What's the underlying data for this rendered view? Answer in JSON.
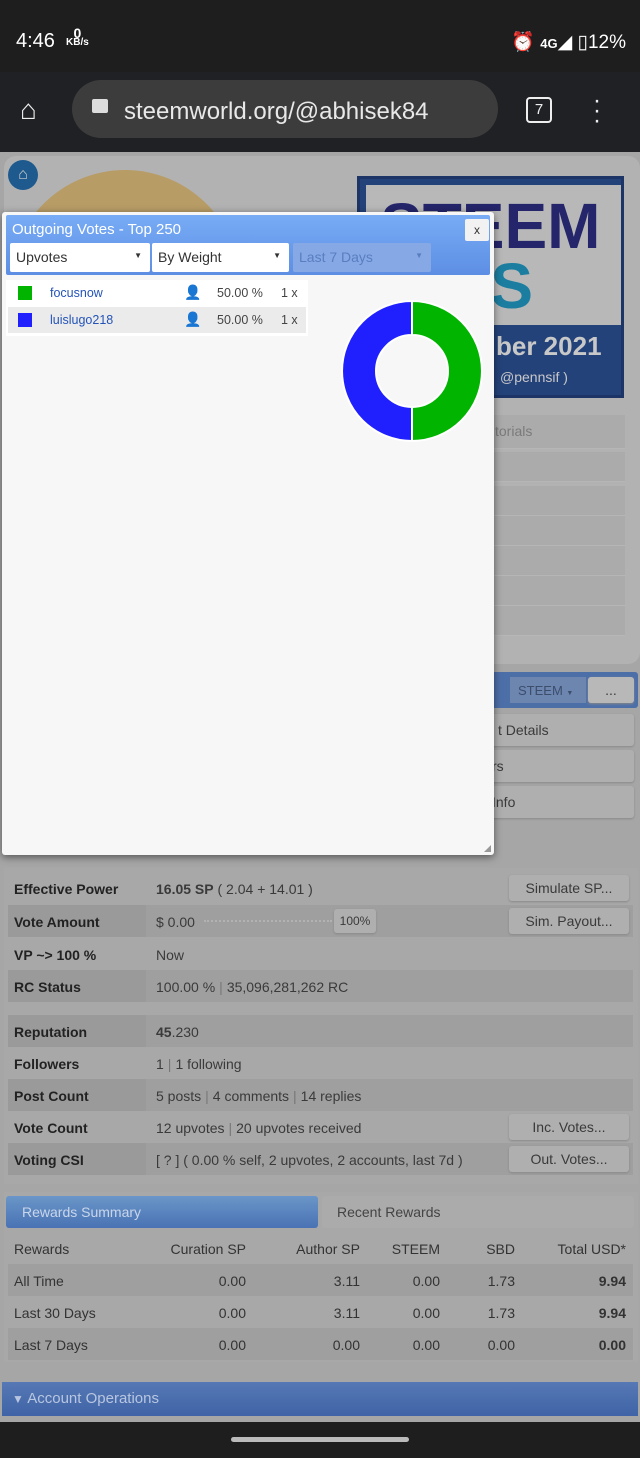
{
  "status_bar": {
    "time": "4:46",
    "speed_value": "0",
    "speed_unit": "KB/s",
    "icons": [
      "alarm-icon",
      "volte-icon",
      "4g-signal-icon",
      "battery-icon"
    ],
    "net": "4G",
    "battery": "12%"
  },
  "browser": {
    "url": "steemworld.org/@abhisek84",
    "tab_count": "7"
  },
  "background": {
    "banner_line1": "STEEM",
    "banner_line2": "WS",
    "banner_date": "ber 2021",
    "banner_author": "@pennsif )",
    "menu_first": "torials",
    "wallet_select": "STEEM",
    "more_button": "...",
    "side_items": [
      "t Details",
      "rs",
      "Info"
    ]
  },
  "popup": {
    "title": "Outgoing Votes - Top 250",
    "close": "x",
    "type_select": "Upvotes",
    "sort_select": "By Weight",
    "period_select": "Last 7 Days",
    "votes": [
      {
        "name": "focusnow",
        "percent": "50.00 %",
        "count": "1 x",
        "color": "#00b400"
      },
      {
        "name": "luislugo218",
        "percent": "50.00 %",
        "count": "1 x",
        "color": "#2020ff"
      }
    ]
  },
  "chart_data": {
    "type": "pie",
    "donut": true,
    "categories": [
      "focusnow",
      "luislugo218"
    ],
    "values": [
      50,
      50
    ],
    "colors": [
      "#00b400",
      "#2020ff"
    ]
  },
  "stats": {
    "rows": [
      {
        "label": "Effective Power",
        "value": "16.05 SP",
        "extra": "( 2.04 + 14.01 )",
        "button": "Simulate SP..."
      },
      {
        "label": "Vote Amount",
        "value": "$ 0.00",
        "slider": "100%",
        "slider_percent": 100,
        "button": "Sim. Payout..."
      },
      {
        "label": "VP ~> 100 %",
        "value": "Now"
      },
      {
        "label": "RC Status",
        "value": "100.00 %",
        "extra": "35,096,281,262 RC"
      }
    ],
    "rows2": [
      {
        "label": "Reputation",
        "value_bold": "45",
        "value": ".230"
      },
      {
        "label": "Followers",
        "value": "1",
        "extra": "1 following"
      },
      {
        "label": "Post Count",
        "value": "5 posts",
        "extra": "4 comments",
        "extra2": "14 replies"
      },
      {
        "label": "Vote Count",
        "value": "12 upvotes",
        "extra": "20 upvotes received",
        "button": "Inc. Votes..."
      },
      {
        "label": "Voting CSI",
        "value": "[ ? ] ( 0.00 % self, 2 upvotes, 2 accounts, last 7d )",
        "button": "Out. Votes..."
      }
    ]
  },
  "rewards": {
    "tabs": [
      "Rewards Summary",
      "Recent Rewards"
    ],
    "headers": [
      "Rewards",
      "Curation SP",
      "Author SP",
      "STEEM",
      "SBD",
      "Total USD*"
    ],
    "rows": [
      [
        "All Time",
        "0.00",
        "3.11",
        "0.00",
        "1.73",
        "9.94"
      ],
      [
        "Last 30 Days",
        "0.00",
        "3.11",
        "0.00",
        "1.73",
        "9.94"
      ],
      [
        "Last 7 Days",
        "0.00",
        "0.00",
        "0.00",
        "0.00",
        "0.00"
      ]
    ]
  },
  "account_operations": "Account Operations"
}
